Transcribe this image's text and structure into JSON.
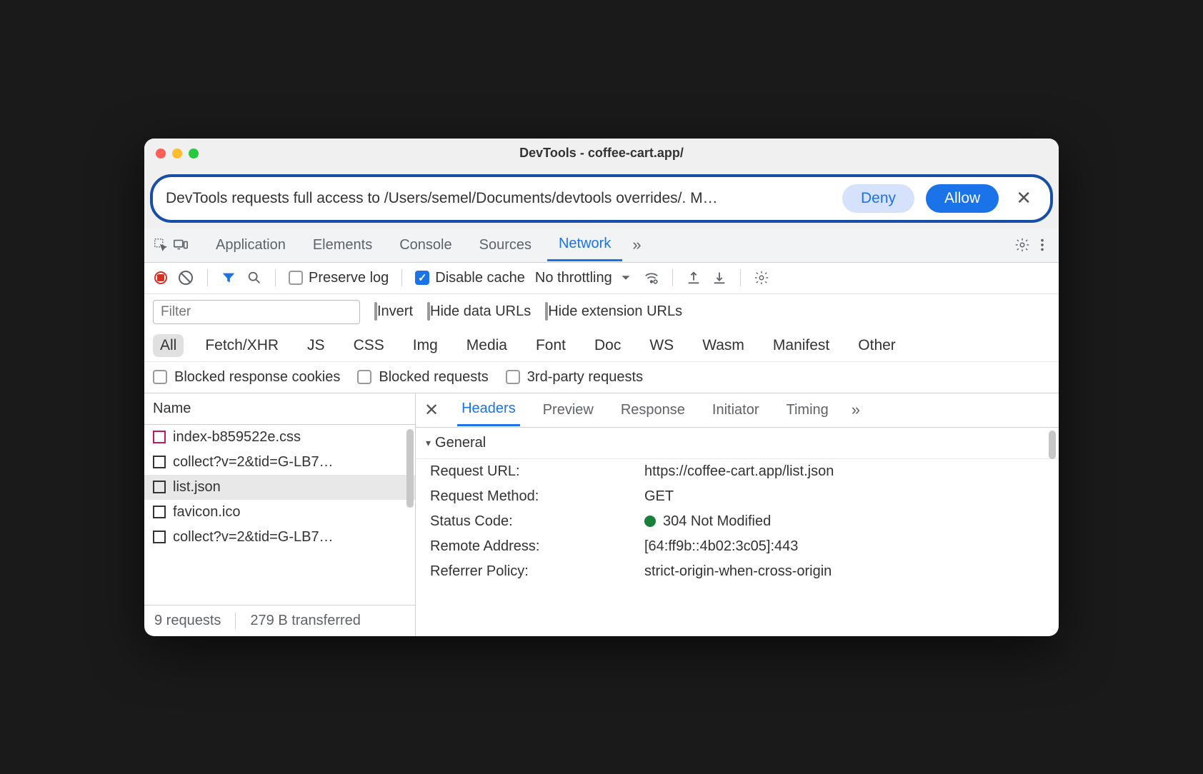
{
  "window": {
    "title": "DevTools - coffee-cart.app/"
  },
  "permission": {
    "message": "DevTools requests full access to /Users/semel/Documents/devtools overrides/. M…",
    "deny": "Deny",
    "allow": "Allow"
  },
  "tabs": {
    "application": "Application",
    "elements": "Elements",
    "console": "Console",
    "sources": "Sources",
    "network": "Network"
  },
  "toolbar": {
    "preserve_log": "Preserve log",
    "disable_cache": "Disable cache",
    "throttling": "No throttling"
  },
  "filter": {
    "placeholder": "Filter",
    "invert": "Invert",
    "hide_data": "Hide data URLs",
    "hide_ext": "Hide extension URLs"
  },
  "types": {
    "all": "All",
    "fetch": "Fetch/XHR",
    "js": "JS",
    "css": "CSS",
    "img": "Img",
    "media": "Media",
    "font": "Font",
    "doc": "Doc",
    "ws": "WS",
    "wasm": "Wasm",
    "manifest": "Manifest",
    "other": "Other"
  },
  "blocked": {
    "cookies": "Blocked response cookies",
    "requests": "Blocked requests",
    "thirdparty": "3rd-party requests"
  },
  "leftcol": {
    "header": "Name"
  },
  "requests": {
    "r0": "index-b859522e.css",
    "r1": "collect?v=2&tid=G-LB7…",
    "r2": "list.json",
    "r3": "favicon.ico",
    "r4": "collect?v=2&tid=G-LB7…"
  },
  "footer": {
    "count": "9 requests",
    "xfer": "279 B transferred"
  },
  "detail_tabs": {
    "headers": "Headers",
    "preview": "Preview",
    "response": "Response",
    "initiator": "Initiator",
    "timing": "Timing"
  },
  "general": {
    "label": "General",
    "url_k": "Request URL:",
    "url_v": "https://coffee-cart.app/list.json",
    "method_k": "Request Method:",
    "method_v": "GET",
    "status_k": "Status Code:",
    "status_v": "304 Not Modified",
    "remote_k": "Remote Address:",
    "remote_v": "[64:ff9b::4b02:3c05]:443",
    "refpol_k": "Referrer Policy:",
    "refpol_v": "strict-origin-when-cross-origin"
  }
}
